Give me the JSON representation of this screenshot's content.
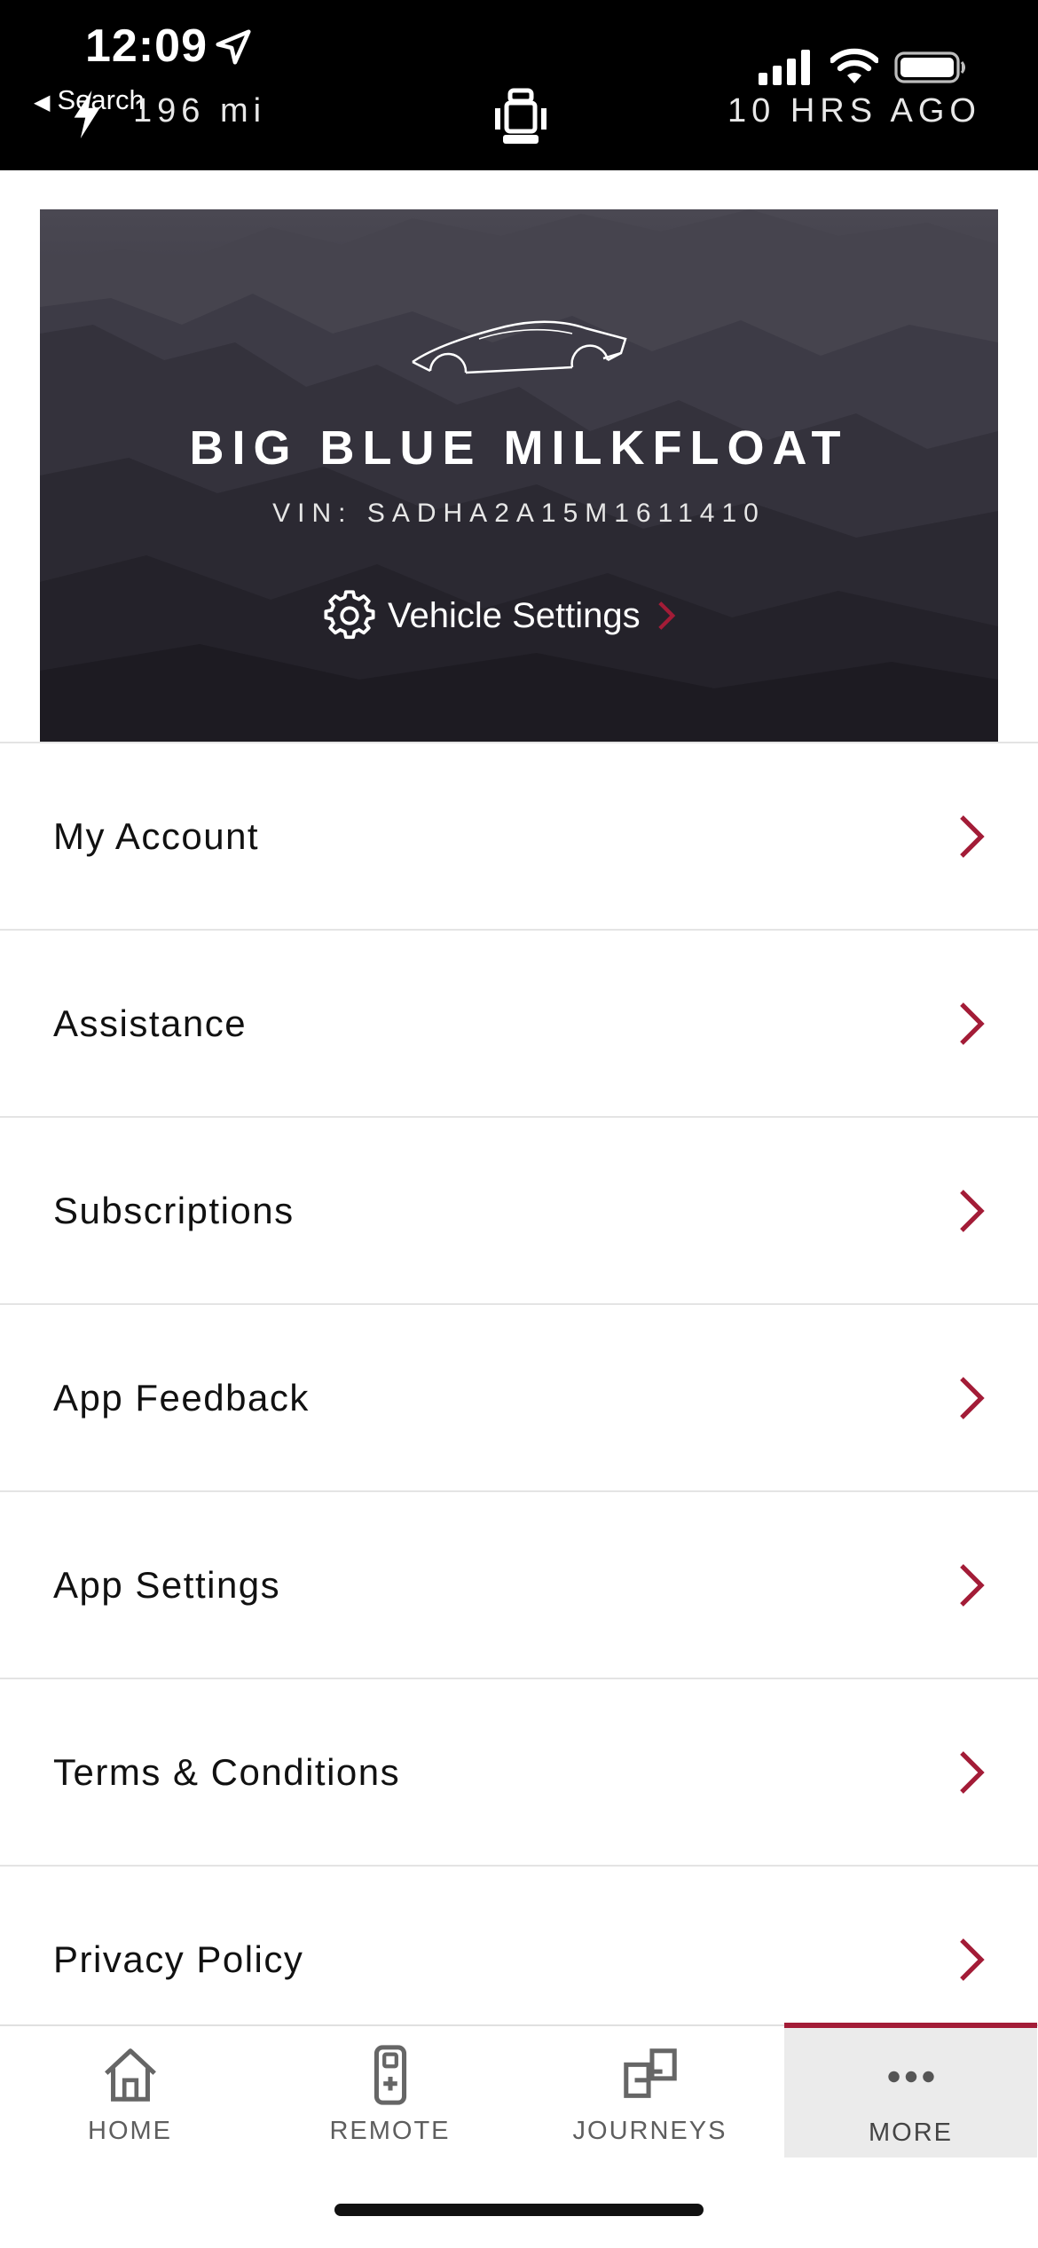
{
  "status_bar": {
    "time": "12:09",
    "back_label": "Search",
    "range": "196 mi",
    "last_update": "10 HRS AGO",
    "icons": [
      "location-arrow-icon",
      "lightning-bolt-icon",
      "vehicle-seat-icon",
      "cellular-signal-icon",
      "wifi-icon",
      "battery-icon"
    ]
  },
  "vehicle": {
    "name": "BIG BLUE MILKFLOAT",
    "vin": "VIN: SADHA2A15M1611410",
    "settings_label": "Vehicle Settings"
  },
  "menu": [
    {
      "label": "My Account"
    },
    {
      "label": "Assistance"
    },
    {
      "label": "Subscriptions"
    },
    {
      "label": "App Feedback"
    },
    {
      "label": "App Settings"
    },
    {
      "label": "Terms & Conditions"
    },
    {
      "label": "Privacy Policy"
    }
  ],
  "tabs": [
    {
      "label": "HOME",
      "icon": "home-icon"
    },
    {
      "label": "REMOTE",
      "icon": "remote-icon"
    },
    {
      "label": "JOURNEYS",
      "icon": "journeys-icon"
    },
    {
      "label": "MORE",
      "icon": "more-icon",
      "active": true
    }
  ],
  "colors": {
    "accent": "#a31c37",
    "status_bar": "#000000",
    "tab_active_bg": "#ebebeb"
  }
}
